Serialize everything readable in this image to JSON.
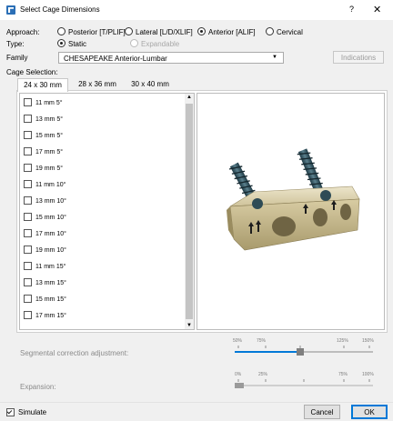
{
  "window": {
    "title": "Select Cage Dimensions",
    "help": "?",
    "close": "✕"
  },
  "approach": {
    "label": "Approach:",
    "options": [
      {
        "label": "Posterior [T/PLIF]",
        "selected": false
      },
      {
        "label": "Lateral [L/D/XLIF]",
        "selected": false
      },
      {
        "label": "Anterior [ALIF]",
        "selected": true
      },
      {
        "label": "Cervical",
        "selected": false
      }
    ]
  },
  "type": {
    "label": "Type:",
    "options": [
      {
        "label": "Static",
        "selected": true,
        "enabled": true
      },
      {
        "label": "Expandable",
        "selected": false,
        "enabled": false
      }
    ]
  },
  "family": {
    "label": "Family",
    "value": "CHESAPEAKE Anterior-Lumbar",
    "arrow": "▼"
  },
  "indications_button": "Indications",
  "cage_selection": {
    "label": "Cage Selection:",
    "tabs": [
      "24 x 30 mm",
      "28 x 36 mm",
      "30 x 40 mm"
    ],
    "active_tab": 0,
    "items": [
      "11 mm 5°",
      "13 mm 5°",
      "15 mm 5°",
      "17 mm 5°",
      "19 mm 5°",
      "11 mm 10°",
      "13 mm 10°",
      "15 mm 10°",
      "17 mm 10°",
      "19 mm 10°",
      "11 mm 15°",
      "13 mm 15°",
      "15 mm 15°",
      "17 mm 15°"
    ],
    "scroll_up": "▲",
    "scroll_down": "▼"
  },
  "segmental": {
    "label": "Segmental correction adjustment:",
    "ticks": [
      "50%",
      "75%",
      "125%",
      "150%"
    ],
    "value_percent": 100
  },
  "expansion": {
    "label": "Expansion:",
    "ticks": [
      "0%",
      "25%",
      "75%",
      "100%"
    ],
    "value_percent": 0
  },
  "simulate": {
    "label": "Simulate",
    "checked": true
  },
  "buttons": {
    "cancel": "Cancel",
    "ok": "OK"
  },
  "colors": {
    "accent": "#0078d7",
    "cage": "#cdbf94",
    "screw": "#2e4b55"
  }
}
